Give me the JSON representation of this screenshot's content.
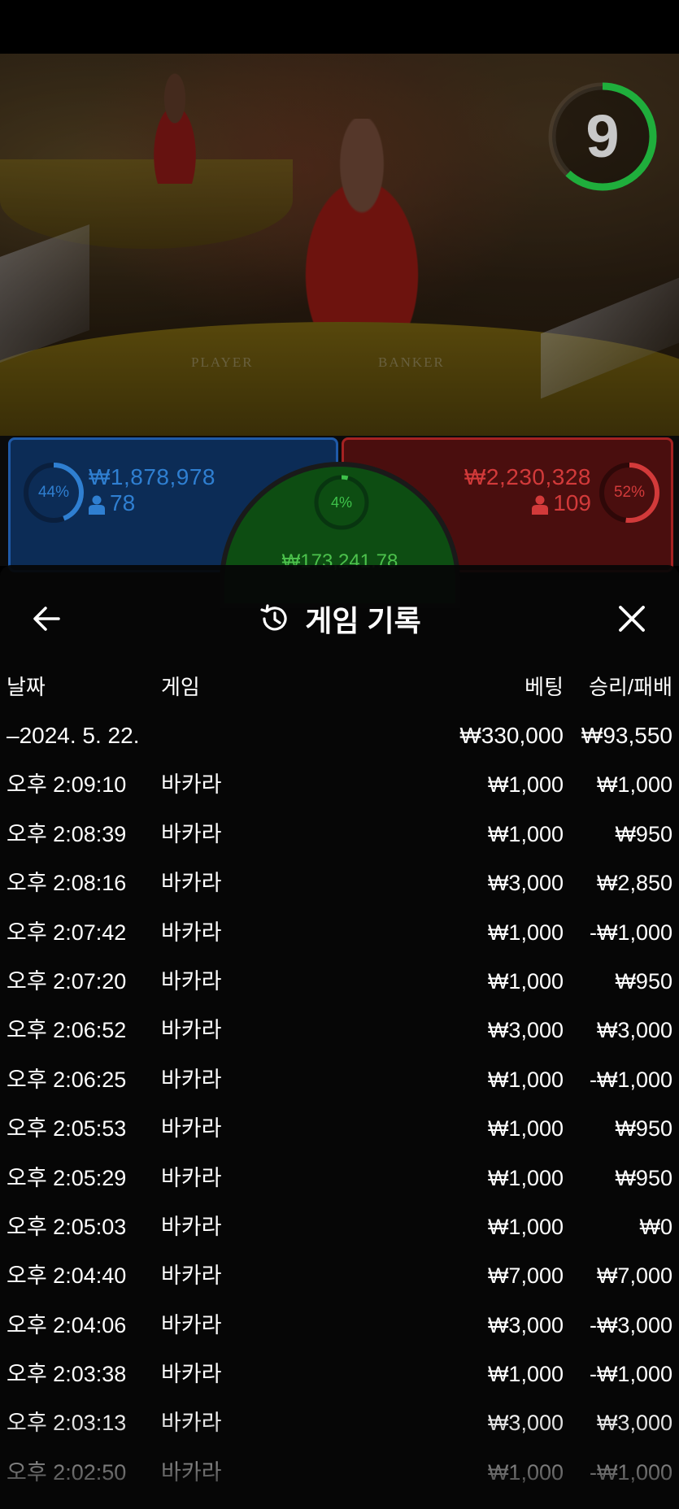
{
  "timer": {
    "value": "9",
    "progress": 0.62
  },
  "table": {
    "player_label": "PLAYER",
    "banker_label": "BANKER"
  },
  "bets": {
    "player": {
      "percent": "44%",
      "amount": "₩1,878,978",
      "players": "78",
      "color": "#2f7fd1"
    },
    "banker": {
      "percent": "52%",
      "amount": "₩2,230,328",
      "players": "109",
      "color": "#d23a3a"
    },
    "tie": {
      "percent": "4%",
      "amount": "₩173,241.78",
      "color": "#3ec24a"
    }
  },
  "history": {
    "title": "게임 기록",
    "columns": {
      "date": "날짜",
      "game": "게임",
      "bet": "베팅",
      "win_loss": "승리/패배"
    },
    "summary": {
      "date": "–2024. 5. 22.",
      "bet": "₩330,000",
      "win_loss": "₩93,550"
    },
    "rows": [
      {
        "time": "오후 2:09:10",
        "game": "바카라",
        "bet": "₩1,000",
        "win_loss": "₩1,000"
      },
      {
        "time": "오후 2:08:39",
        "game": "바카라",
        "bet": "₩1,000",
        "win_loss": "₩950"
      },
      {
        "time": "오후 2:08:16",
        "game": "바카라",
        "bet": "₩3,000",
        "win_loss": "₩2,850"
      },
      {
        "time": "오후 2:07:42",
        "game": "바카라",
        "bet": "₩1,000",
        "win_loss": "-₩1,000"
      },
      {
        "time": "오후 2:07:20",
        "game": "바카라",
        "bet": "₩1,000",
        "win_loss": "₩950"
      },
      {
        "time": "오후 2:06:52",
        "game": "바카라",
        "bet": "₩3,000",
        "win_loss": "₩3,000"
      },
      {
        "time": "오후 2:06:25",
        "game": "바카라",
        "bet": "₩1,000",
        "win_loss": "-₩1,000"
      },
      {
        "time": "오후 2:05:53",
        "game": "바카라",
        "bet": "₩1,000",
        "win_loss": "₩950"
      },
      {
        "time": "오후 2:05:29",
        "game": "바카라",
        "bet": "₩1,000",
        "win_loss": "₩950"
      },
      {
        "time": "오후 2:05:03",
        "game": "바카라",
        "bet": "₩1,000",
        "win_loss": "₩0"
      },
      {
        "time": "오후 2:04:40",
        "game": "바카라",
        "bet": "₩7,000",
        "win_loss": "₩7,000"
      },
      {
        "time": "오후 2:04:06",
        "game": "바카라",
        "bet": "₩3,000",
        "win_loss": "-₩3,000"
      },
      {
        "time": "오후 2:03:38",
        "game": "바카라",
        "bet": "₩1,000",
        "win_loss": "-₩1,000"
      },
      {
        "time": "오후 2:03:13",
        "game": "바카라",
        "bet": "₩3,000",
        "win_loss": "₩3,000"
      },
      {
        "time": "오후 2:02:50",
        "game": "바카라",
        "bet": "₩1,000",
        "win_loss": "-₩1,000"
      }
    ]
  }
}
